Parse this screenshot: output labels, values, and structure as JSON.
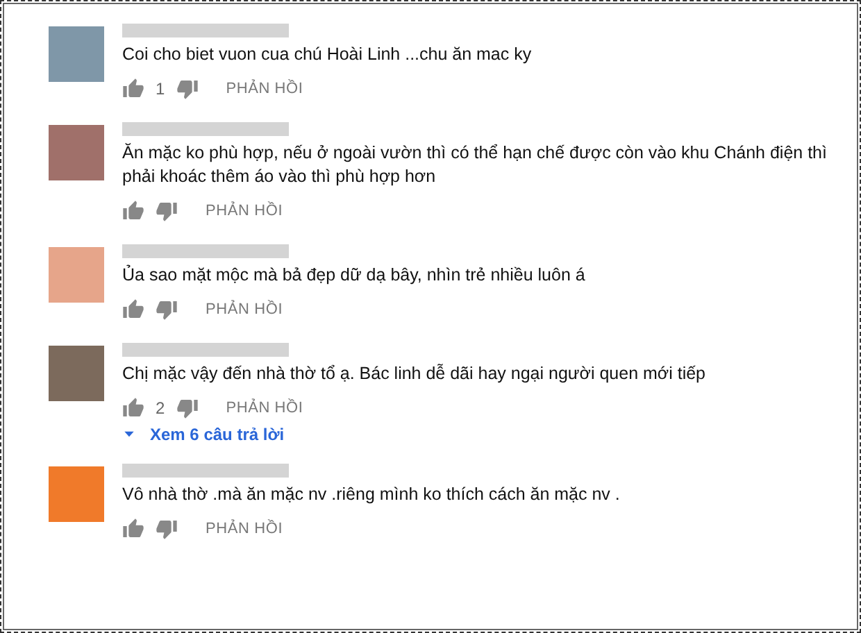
{
  "comments": [
    {
      "color": "#7f97a8",
      "text": "Coi cho biet vuon cua chú Hoài Linh ...chu ăn mac ky",
      "likes": "1",
      "reply": "PHẢN HỒI"
    },
    {
      "color": "#a0706a",
      "text": "Ăn mặc ko phù hợp, nếu ở ngoài vườn thì có thể hạn chế được còn vào khu Chánh điện thì phải khoác thêm áo vào thì phù hợp hơn",
      "reply": "PHẢN HỒI"
    },
    {
      "color": "#e6a58a",
      "text": "Ủa sao mặt mộc mà bả đẹp dữ dạ bây, nhìn trẻ nhiều luôn á",
      "reply": "PHẢN HỒI"
    },
    {
      "color": "#7c6a5c",
      "text": "Chị mặc vậy đến nhà thờ tổ ạ. Bác linh dễ dãi hay ngại người quen mới tiếp",
      "likes": "2",
      "reply": "PHẢN HỒI",
      "replies_link": "Xem 6 câu trả lời"
    },
    {
      "color": "#f07a2a",
      "text": "Vô nhà thờ .mà ăn mặc nv .riêng mình ko thích cách ăn mặc nv .",
      "reply": "PHẢN HỒI"
    }
  ]
}
